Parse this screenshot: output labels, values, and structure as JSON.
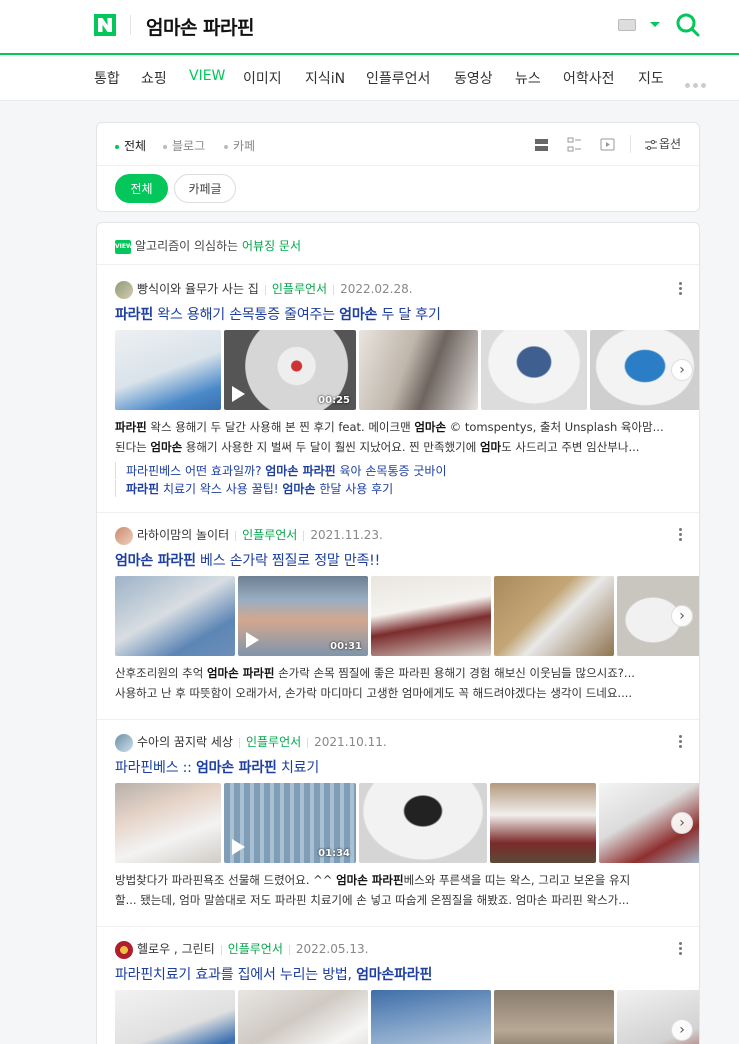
{
  "header": {
    "logo": "N",
    "query": "엄마손 파라핀",
    "accent": "#03c75a"
  },
  "tabs": [
    {
      "label": "통합",
      "active": false
    },
    {
      "label": "쇼핑",
      "active": false
    },
    {
      "label": "VIEW",
      "active": true
    },
    {
      "label": "이미지",
      "active": false
    },
    {
      "label": "지식iN",
      "active": false
    },
    {
      "label": "인플루언서",
      "active": false
    },
    {
      "label": "동영상",
      "active": false
    },
    {
      "label": "뉴스",
      "active": false
    },
    {
      "label": "어학사전",
      "active": false
    },
    {
      "label": "지도",
      "active": false
    }
  ],
  "filter": {
    "types": [
      "전체",
      "블로그",
      "카페"
    ],
    "options_label": "옵션",
    "chips": [
      "전체",
      "카페글"
    ]
  },
  "notice": {
    "badge": "VIEW",
    "text_prefix": "알고리즘이 의심하는 ",
    "text_highlight": "어뷰징 문서"
  },
  "posts": [
    {
      "author": "빵식이와 율무가 사는 집",
      "badge": "인플루언서",
      "date": "2022.02.28.",
      "title": "파라핀 왁스 용해기 손목통증 줄여주는 엄마손 두 달 후기",
      "video_duration": "00:25",
      "snippet1": "파라핀 왁스 용해기 두 달간 사용해 본 찐 후기 feat. 메이크맨 엄마손 © tomspentys, 출처 Unsplash 육아맘...",
      "snippet2": "된다는 엄마손 용해기 사용한 지 벌써 두 달이 훨씬 지났어요. 찐 만족했기에 엄마도 사드리고 주변 임산부나...",
      "sublinks": [
        "파라핀베스 어떤 효과일까? 엄마손 파라핀 육아 손목통증 굿바이",
        "파라핀 치료기 왁스 사용 꿀팁! 엄마손 한달 사용 후기"
      ]
    },
    {
      "author": "라하이맘의 놀이터",
      "badge": "인플루언서",
      "date": "2021.11.23.",
      "title": "엄마손 파라핀 베스 손가락 찜질로 정말 만족!!",
      "video_duration": "00:31",
      "snippet1": "산후조리원의 추억 엄마손 파라핀 손가락 손목 찜질에 좋은 파라핀 용해기 경험 해보신 이웃님들 많으시죠?...",
      "snippet2": "사용하고 난 후 따뜻함이 오래가서, 손가락 마디마디 고생한 엄마에게도 꼭 해드려야겠다는 생각이 드네요...."
    },
    {
      "author": "수아의 꿈지락 세상",
      "badge": "인플루언서",
      "date": "2021.10.11.",
      "title": "파라핀베스 :: 엄마손 파라핀 치료기",
      "video_duration": "01:34",
      "snippet1": "방법찾다가 파라핀욕조 선물해 드렸어요. ^^ 엄마손 파라핀베스와 푸른색을 띠는 왁스, 그리고 보온을 유지",
      "snippet2": "할... 됐는데, 엄마 말씀대로 저도 파라핀 치료기에 손 넣고 따숩게 온찜질을 해봤죠. 엄마손 파리핀 왁스가..."
    },
    {
      "author": "헬로우 , 그린티",
      "badge": "인플루언서",
      "date": "2022.05.13.",
      "title": "파라핀치료기 효과를 집에서 누리는 방법, 엄마손파라핀"
    }
  ]
}
